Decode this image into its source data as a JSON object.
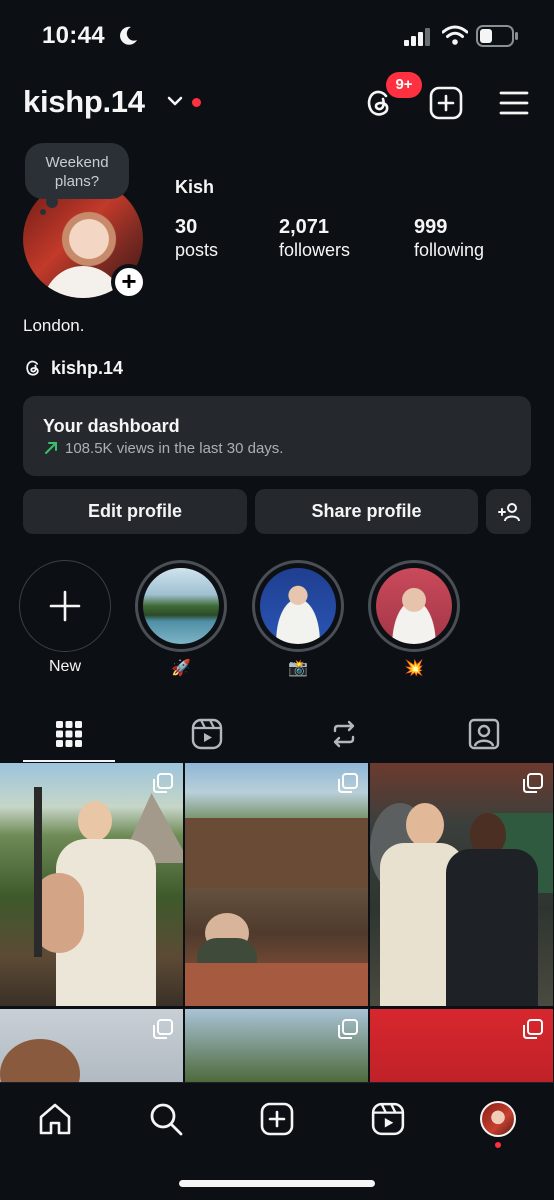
{
  "status": {
    "time": "10:44"
  },
  "header": {
    "username": "kishp.14",
    "threads_badge": "9+"
  },
  "profile": {
    "note": "Weekend plans?",
    "display_name": "Kish",
    "stats": [
      {
        "value": "30",
        "label": "posts"
      },
      {
        "value": "2,071",
        "label": "followers"
      },
      {
        "value": "999",
        "label": "following"
      }
    ],
    "bio": "London.",
    "threads_handle": "kishp.14"
  },
  "dashboard": {
    "title": "Your dashboard",
    "subtitle": "108.5K views in the last 30 days."
  },
  "buttons": {
    "edit": "Edit profile",
    "share": "Share profile"
  },
  "highlights": [
    {
      "label": "New"
    },
    {
      "label": "🚀"
    },
    {
      "label": "📸"
    },
    {
      "label": "💥"
    }
  ],
  "tabs": [
    "grid-icon",
    "reels-icon",
    "reposts-icon",
    "tagged-icon"
  ],
  "bottom_nav": [
    "home-icon",
    "search-icon",
    "create-icon",
    "reels-icon",
    "profile-avatar"
  ],
  "colors": {
    "background": "#0c1014",
    "surface": "#25292e",
    "accent_red": "#ff3040",
    "trend_green": "#3bbf6b"
  }
}
